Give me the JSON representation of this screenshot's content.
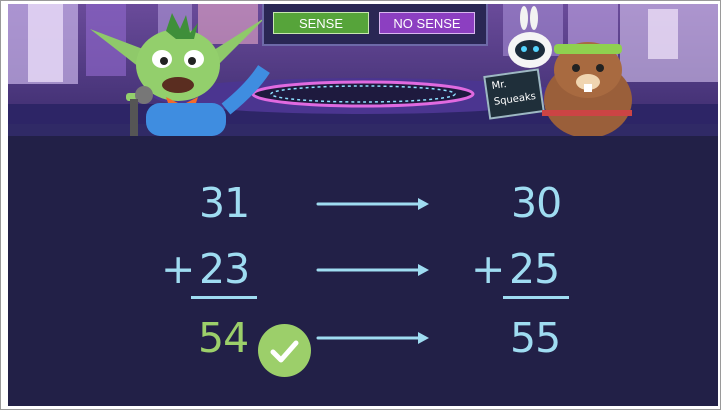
{
  "buttons": {
    "sense_label": "SENSE",
    "no_sense_label": "NO SENSE"
  },
  "scene": {
    "sign_text_line1": "Mr.",
    "sign_text_line2": "Squeaks",
    "characters": [
      "alien-host-character",
      "robot-character",
      "hamster-character-mr-squeaks"
    ]
  },
  "problem": {
    "original": {
      "top": "31",
      "sign": "+",
      "bottom": "23",
      "answer": "54"
    },
    "estimate": {
      "top": "30",
      "sign": "+",
      "bottom": "25",
      "answer": "55"
    },
    "answer_status": "correct"
  },
  "colors": {
    "board_bg": "#222047",
    "numbers": "#9fdcf1",
    "answer_green": "#9ccf6a",
    "sense_button": "#56a43a",
    "no_sense_button": "#8c3fc1"
  }
}
